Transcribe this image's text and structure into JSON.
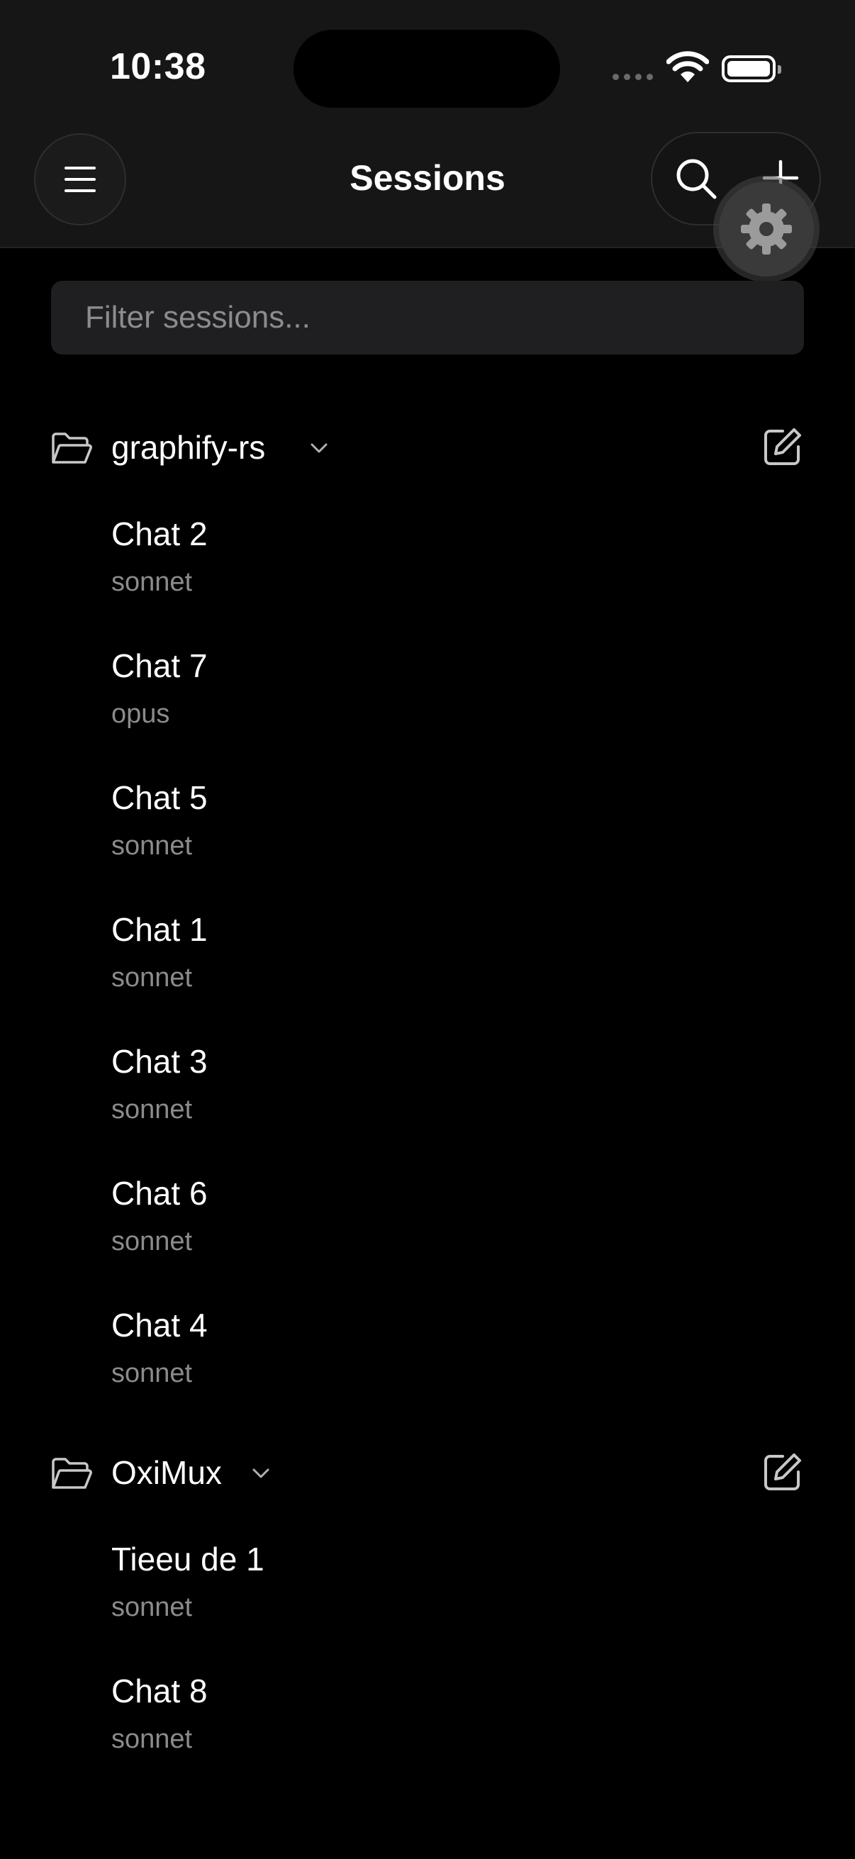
{
  "status_bar": {
    "time": "10:38"
  },
  "header": {
    "title": "Sessions"
  },
  "filter": {
    "placeholder": "Filter sessions..."
  },
  "groups": [
    {
      "name": "graphify-rs",
      "sessions": [
        {
          "title": "Chat 2",
          "model": "sonnet"
        },
        {
          "title": "Chat 7",
          "model": "opus"
        },
        {
          "title": "Chat 5",
          "model": "sonnet"
        },
        {
          "title": "Chat 1",
          "model": "sonnet"
        },
        {
          "title": "Chat 3",
          "model": "sonnet"
        },
        {
          "title": "Chat 6",
          "model": "sonnet"
        },
        {
          "title": "Chat 4",
          "model": "sonnet"
        }
      ]
    },
    {
      "name": "OxiMux",
      "sessions": [
        {
          "title": "Tieeu de 1",
          "model": "sonnet"
        },
        {
          "title": "Chat 8",
          "model": "sonnet"
        }
      ]
    }
  ],
  "icons": {
    "menu": "hamburger-menu-icon",
    "search": "search-icon",
    "add": "plus-icon",
    "settings": "gear-icon",
    "folder": "folder-open-icon",
    "collapse": "chevron-down-icon",
    "edit": "edit-icon"
  },
  "colors": {
    "background": "#000000",
    "header_bg": "#161616",
    "input_bg": "#1f1f21",
    "secondary_text": "#8b8b8e"
  }
}
